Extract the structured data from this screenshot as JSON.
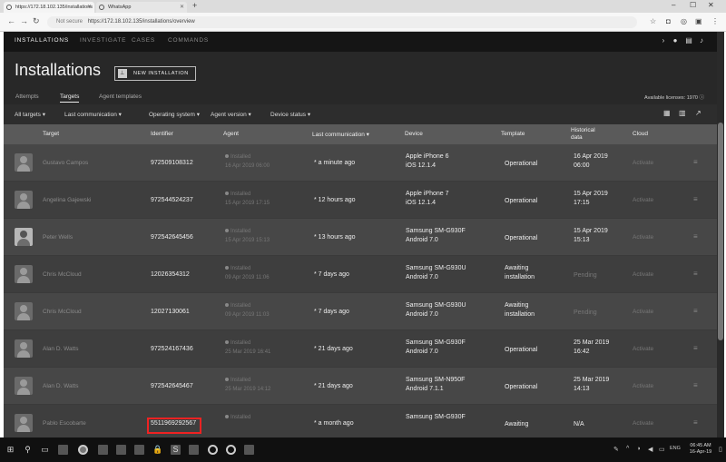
{
  "browser": {
    "tabs": [
      {
        "label": "https://172.18.102.135/installations"
      },
      {
        "label": "WhatsApp"
      }
    ],
    "url_notice": "Not secure",
    "url": "https://172.18.102.135/installations/overview"
  },
  "nav": {
    "items": [
      "INSTALLATIONS",
      "INVESTIGATE",
      "CASES",
      "COMMANDS"
    ]
  },
  "header": {
    "title": "Installations",
    "new_button": "NEW INSTALLATION",
    "subtabs": [
      "Attempts",
      "Targets",
      "Agent templates"
    ],
    "licenses": "Available licenses: 1970"
  },
  "filters": [
    "All targets",
    "Last communication",
    "Operating system",
    "Agent version",
    "Device status"
  ],
  "table": {
    "columns": [
      "Target",
      "Identifier",
      "Agent",
      "Last communication",
      "Device",
      "Template",
      "Historical data",
      "Cloud"
    ],
    "rows": [
      {
        "target": "Gustavo Campos",
        "identifier": "972509108312",
        "agent_status": "Installed",
        "agent_date": "16 Apr 2019 06:00",
        "last": "a minute ago",
        "device": "Apple iPhone 6",
        "os": "iOS 12.1.4",
        "template": "Operational",
        "hist1": "16 Apr 2019",
        "hist2": "06:00",
        "cloud": "Activate"
      },
      {
        "target": "Angelina Gajewski",
        "identifier": "972544524237",
        "agent_status": "Installed",
        "agent_date": "15 Apr 2019 17:15",
        "last": "12 hours ago",
        "device": "Apple iPhone 7",
        "os": "iOS 12.1.4",
        "template": "Operational",
        "hist1": "15 Apr 2019",
        "hist2": "17:15",
        "cloud": "Activate"
      },
      {
        "target": "Peter Wells",
        "identifier": "972542645456",
        "agent_status": "Installed",
        "agent_date": "15 Apr 2019 15:13",
        "last": "13 hours ago",
        "device": "Samsung SM-G930F",
        "os": "Android 7.0",
        "template": "Operational",
        "hist1": "15 Apr 2019",
        "hist2": "15:13",
        "cloud": "Activate"
      },
      {
        "target": "Chris McCloud",
        "identifier": "12026354312",
        "agent_status": "Installed",
        "agent_date": "09 Apr 2019 11:06",
        "last": "7 days ago",
        "device": "Samsung SM-G930U",
        "os": "Android 7.0",
        "template": "Awaiting",
        "template2": "installation",
        "hist1": "Pending",
        "hist2": "",
        "cloud": "Activate"
      },
      {
        "target": "Chris McCloud",
        "identifier": "12027130061",
        "agent_status": "Installed",
        "agent_date": "09 Apr 2019 11:03",
        "last": "7 days ago",
        "device": "Samsung SM-G930U",
        "os": "Android 7.0",
        "template": "Awaiting",
        "template2": "installation",
        "hist1": "Pending",
        "hist2": "",
        "cloud": "Activate"
      },
      {
        "target": "Alan D. Watts",
        "identifier": "972524167436",
        "agent_status": "Installed",
        "agent_date": "25 Mar 2019 16:41",
        "last": "21 days ago",
        "device": "Samsung SM-G930F",
        "os": "Android 7.0",
        "template": "Operational",
        "hist1": "25 Mar 2019",
        "hist2": "16:42",
        "cloud": "Activate"
      },
      {
        "target": "Alan D. Watts",
        "identifier": "972542645467",
        "agent_status": "Installed",
        "agent_date": "25 Mar 2019 14:12",
        "last": "21 days ago",
        "device": "Samsung SM-N950F",
        "os": "Android 7.1.1",
        "template": "Operational",
        "hist1": "25 Mar 2019",
        "hist2": "14:13",
        "cloud": "Activate"
      },
      {
        "target": "Pablo Escobarte",
        "identifier": "5511969292567",
        "agent_status": "Installed",
        "agent_date": "",
        "last": "a month ago",
        "device": "Samsung SM-G930F",
        "os": "",
        "template": "Awaiting",
        "template2": "",
        "hist1": "N/A",
        "hist2": "",
        "cloud": "Activate"
      }
    ]
  },
  "taskbar": {
    "time": "06:45 AM",
    "date": "16-Apr-19",
    "lang": "ENG"
  }
}
